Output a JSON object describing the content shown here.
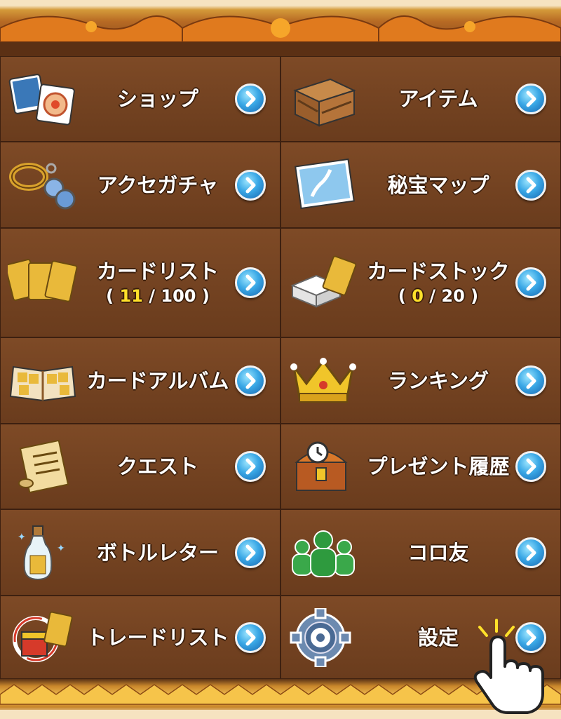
{
  "menu": [
    {
      "label": "ショップ",
      "icon": "shop-cards-icon"
    },
    {
      "label": "アイテム",
      "icon": "wooden-crate-icon"
    },
    {
      "label": "アクセガチャ",
      "icon": "accessory-ring-icon"
    },
    {
      "label": "秘宝マップ",
      "icon": "treasure-map-icon"
    },
    {
      "label": "カードリスト",
      "icon": "card-stack-icon",
      "count_open": "(",
      "count_current": "11",
      "count_sep": "/",
      "count_max": "100",
      "count_close": ")"
    },
    {
      "label": "カードストック",
      "icon": "card-box-icon",
      "count_open": "(",
      "count_current": "0",
      "count_sep": "/",
      "count_max": "20",
      "count_close": ")"
    },
    {
      "label": "カードアルバム",
      "icon": "card-album-icon"
    },
    {
      "label": "ランキング",
      "icon": "crown-icon"
    },
    {
      "label": "クエスト",
      "icon": "quest-scroll-icon"
    },
    {
      "label": "プレゼント履歴",
      "icon": "treasure-chest-clock-icon"
    },
    {
      "label": "ボトルレター",
      "icon": "message-bottle-icon"
    },
    {
      "label": "コロ友",
      "icon": "friends-icon"
    },
    {
      "label": "トレードリスト",
      "icon": "trade-chest-icon"
    },
    {
      "label": "設定",
      "icon": "gear-icon"
    }
  ],
  "colors": {
    "panel": "#6f4020",
    "text": "#ffffff",
    "count_highlight": "#ffe12a",
    "arrow": "#3aa8e6"
  }
}
